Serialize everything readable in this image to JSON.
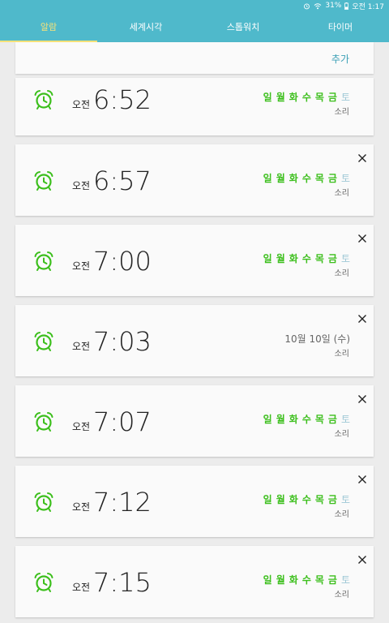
{
  "status": {
    "battery": "31%",
    "time": "오전 1:17"
  },
  "tabs": [
    {
      "label": "알람",
      "active": true
    },
    {
      "label": "세계시각",
      "active": false
    },
    {
      "label": "스톱워치",
      "active": false
    },
    {
      "label": "타이머",
      "active": false
    }
  ],
  "add_label": "추가",
  "colors": {
    "header": "#4fb9cb",
    "active_tab": "#f5e27a",
    "day_on": "#3cbf1c",
    "day_off": "#9fc8d6",
    "icon": "#3cbf1c"
  },
  "alarms": [
    {
      "ampm": "오전",
      "time": "6:52",
      "days": [
        "일",
        "월",
        "화",
        "수",
        "목",
        "금",
        "토"
      ],
      "sound": "소리",
      "icon": "alarm-clock-icon"
    },
    {
      "ampm": "오전",
      "time": "6:57",
      "days": [
        "일",
        "월",
        "화",
        "수",
        "목",
        "금",
        "토"
      ],
      "sound": "소리",
      "icon": "alarm-clock-icon"
    },
    {
      "ampm": "오전",
      "time": "7:00",
      "days": [
        "일",
        "월",
        "화",
        "수",
        "목",
        "금",
        "토"
      ],
      "sound": "소리",
      "icon": "alarm-clock-icon"
    },
    {
      "ampm": "오전",
      "time": "7:03",
      "date": "10월 10일 (수)",
      "sound": "소리",
      "icon": "alarm-clock-icon"
    },
    {
      "ampm": "오전",
      "time": "7:07",
      "days": [
        "일",
        "월",
        "화",
        "수",
        "목",
        "금",
        "토"
      ],
      "sound": "소리",
      "icon": "alarm-clock-icon"
    },
    {
      "ampm": "오전",
      "time": "7:12",
      "days": [
        "일",
        "월",
        "화",
        "수",
        "목",
        "금",
        "토"
      ],
      "sound": "소리",
      "icon": "alarm-clock-icon"
    },
    {
      "ampm": "오전",
      "time": "7:15",
      "days": [
        "일",
        "월",
        "화",
        "수",
        "목",
        "금",
        "토"
      ],
      "sound": "소리",
      "icon": "alarm-clock-icon"
    }
  ]
}
